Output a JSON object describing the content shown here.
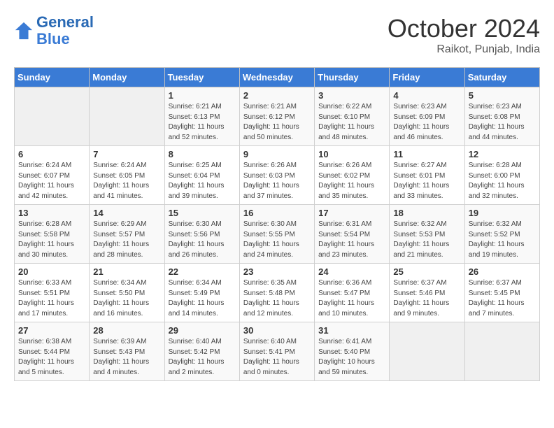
{
  "header": {
    "logo_general": "General",
    "logo_blue": "Blue",
    "month": "October 2024",
    "location": "Raikot, Punjab, India"
  },
  "days_of_week": [
    "Sunday",
    "Monday",
    "Tuesday",
    "Wednesday",
    "Thursday",
    "Friday",
    "Saturday"
  ],
  "weeks": [
    [
      {
        "day": "",
        "sunrise": "",
        "sunset": "",
        "daylight": ""
      },
      {
        "day": "",
        "sunrise": "",
        "sunset": "",
        "daylight": ""
      },
      {
        "day": "1",
        "sunrise": "Sunrise: 6:21 AM",
        "sunset": "Sunset: 6:13 PM",
        "daylight": "Daylight: 11 hours and 52 minutes."
      },
      {
        "day": "2",
        "sunrise": "Sunrise: 6:21 AM",
        "sunset": "Sunset: 6:12 PM",
        "daylight": "Daylight: 11 hours and 50 minutes."
      },
      {
        "day": "3",
        "sunrise": "Sunrise: 6:22 AM",
        "sunset": "Sunset: 6:10 PM",
        "daylight": "Daylight: 11 hours and 48 minutes."
      },
      {
        "day": "4",
        "sunrise": "Sunrise: 6:23 AM",
        "sunset": "Sunset: 6:09 PM",
        "daylight": "Daylight: 11 hours and 46 minutes."
      },
      {
        "day": "5",
        "sunrise": "Sunrise: 6:23 AM",
        "sunset": "Sunset: 6:08 PM",
        "daylight": "Daylight: 11 hours and 44 minutes."
      }
    ],
    [
      {
        "day": "6",
        "sunrise": "Sunrise: 6:24 AM",
        "sunset": "Sunset: 6:07 PM",
        "daylight": "Daylight: 11 hours and 42 minutes."
      },
      {
        "day": "7",
        "sunrise": "Sunrise: 6:24 AM",
        "sunset": "Sunset: 6:05 PM",
        "daylight": "Daylight: 11 hours and 41 minutes."
      },
      {
        "day": "8",
        "sunrise": "Sunrise: 6:25 AM",
        "sunset": "Sunset: 6:04 PM",
        "daylight": "Daylight: 11 hours and 39 minutes."
      },
      {
        "day": "9",
        "sunrise": "Sunrise: 6:26 AM",
        "sunset": "Sunset: 6:03 PM",
        "daylight": "Daylight: 11 hours and 37 minutes."
      },
      {
        "day": "10",
        "sunrise": "Sunrise: 6:26 AM",
        "sunset": "Sunset: 6:02 PM",
        "daylight": "Daylight: 11 hours and 35 minutes."
      },
      {
        "day": "11",
        "sunrise": "Sunrise: 6:27 AM",
        "sunset": "Sunset: 6:01 PM",
        "daylight": "Daylight: 11 hours and 33 minutes."
      },
      {
        "day": "12",
        "sunrise": "Sunrise: 6:28 AM",
        "sunset": "Sunset: 6:00 PM",
        "daylight": "Daylight: 11 hours and 32 minutes."
      }
    ],
    [
      {
        "day": "13",
        "sunrise": "Sunrise: 6:28 AM",
        "sunset": "Sunset: 5:58 PM",
        "daylight": "Daylight: 11 hours and 30 minutes."
      },
      {
        "day": "14",
        "sunrise": "Sunrise: 6:29 AM",
        "sunset": "Sunset: 5:57 PM",
        "daylight": "Daylight: 11 hours and 28 minutes."
      },
      {
        "day": "15",
        "sunrise": "Sunrise: 6:30 AM",
        "sunset": "Sunset: 5:56 PM",
        "daylight": "Daylight: 11 hours and 26 minutes."
      },
      {
        "day": "16",
        "sunrise": "Sunrise: 6:30 AM",
        "sunset": "Sunset: 5:55 PM",
        "daylight": "Daylight: 11 hours and 24 minutes."
      },
      {
        "day": "17",
        "sunrise": "Sunrise: 6:31 AM",
        "sunset": "Sunset: 5:54 PM",
        "daylight": "Daylight: 11 hours and 23 minutes."
      },
      {
        "day": "18",
        "sunrise": "Sunrise: 6:32 AM",
        "sunset": "Sunset: 5:53 PM",
        "daylight": "Daylight: 11 hours and 21 minutes."
      },
      {
        "day": "19",
        "sunrise": "Sunrise: 6:32 AM",
        "sunset": "Sunset: 5:52 PM",
        "daylight": "Daylight: 11 hours and 19 minutes."
      }
    ],
    [
      {
        "day": "20",
        "sunrise": "Sunrise: 6:33 AM",
        "sunset": "Sunset: 5:51 PM",
        "daylight": "Daylight: 11 hours and 17 minutes."
      },
      {
        "day": "21",
        "sunrise": "Sunrise: 6:34 AM",
        "sunset": "Sunset: 5:50 PM",
        "daylight": "Daylight: 11 hours and 16 minutes."
      },
      {
        "day": "22",
        "sunrise": "Sunrise: 6:34 AM",
        "sunset": "Sunset: 5:49 PM",
        "daylight": "Daylight: 11 hours and 14 minutes."
      },
      {
        "day": "23",
        "sunrise": "Sunrise: 6:35 AM",
        "sunset": "Sunset: 5:48 PM",
        "daylight": "Daylight: 11 hours and 12 minutes."
      },
      {
        "day": "24",
        "sunrise": "Sunrise: 6:36 AM",
        "sunset": "Sunset: 5:47 PM",
        "daylight": "Daylight: 11 hours and 10 minutes."
      },
      {
        "day": "25",
        "sunrise": "Sunrise: 6:37 AM",
        "sunset": "Sunset: 5:46 PM",
        "daylight": "Daylight: 11 hours and 9 minutes."
      },
      {
        "day": "26",
        "sunrise": "Sunrise: 6:37 AM",
        "sunset": "Sunset: 5:45 PM",
        "daylight": "Daylight: 11 hours and 7 minutes."
      }
    ],
    [
      {
        "day": "27",
        "sunrise": "Sunrise: 6:38 AM",
        "sunset": "Sunset: 5:44 PM",
        "daylight": "Daylight: 11 hours and 5 minutes."
      },
      {
        "day": "28",
        "sunrise": "Sunrise: 6:39 AM",
        "sunset": "Sunset: 5:43 PM",
        "daylight": "Daylight: 11 hours and 4 minutes."
      },
      {
        "day": "29",
        "sunrise": "Sunrise: 6:40 AM",
        "sunset": "Sunset: 5:42 PM",
        "daylight": "Daylight: 11 hours and 2 minutes."
      },
      {
        "day": "30",
        "sunrise": "Sunrise: 6:40 AM",
        "sunset": "Sunset: 5:41 PM",
        "daylight": "Daylight: 11 hours and 0 minutes."
      },
      {
        "day": "31",
        "sunrise": "Sunrise: 6:41 AM",
        "sunset": "Sunset: 5:40 PM",
        "daylight": "Daylight: 10 hours and 59 minutes."
      },
      {
        "day": "",
        "sunrise": "",
        "sunset": "",
        "daylight": ""
      },
      {
        "day": "",
        "sunrise": "",
        "sunset": "",
        "daylight": ""
      }
    ]
  ]
}
